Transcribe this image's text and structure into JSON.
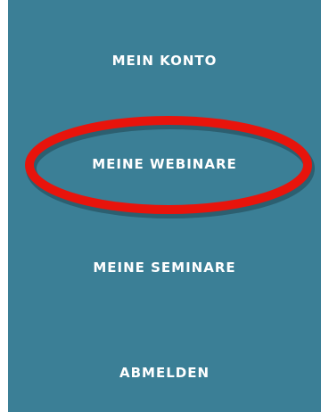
{
  "menu": {
    "items": [
      {
        "label": "MEIN KONTO"
      },
      {
        "label": "MEINE WEBINARE"
      },
      {
        "label": "MEINE SEMINARE"
      },
      {
        "label": "ABMELDEN"
      }
    ]
  },
  "colors": {
    "panel_background": "#3b7f96",
    "text": "#ffffff",
    "highlight_ring": "#e8140c"
  }
}
